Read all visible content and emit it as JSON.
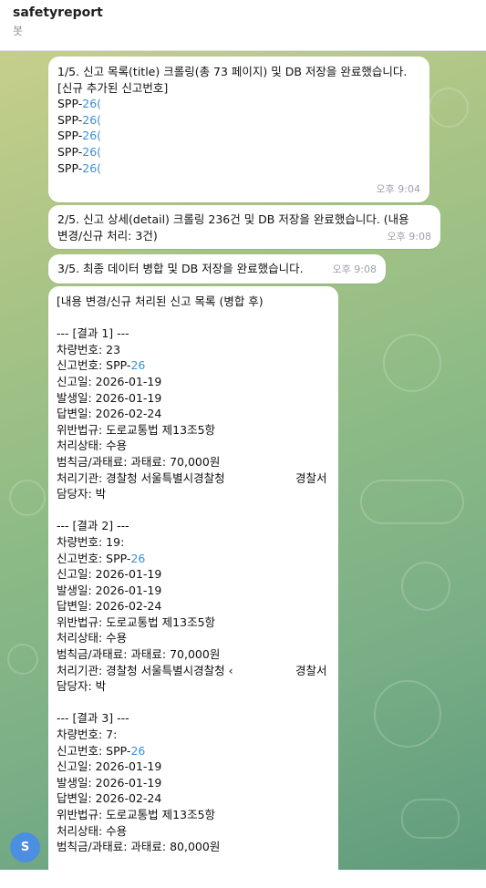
{
  "header": {
    "title": "safetyreport",
    "subtitle": "봇"
  },
  "messages": {
    "m1": {
      "lines": [
        "1/5. 신고 목록(title) 크롤링(총 73 페이지) 및 DB 저장을 완료했습니다.",
        "",
        "[신규 추가된 신고번호]"
      ],
      "spp_prefix": "SPP-",
      "spp_suffix": "26(",
      "time": "오후 9:04"
    },
    "m2": {
      "line1": "2/5. 신고 상세(detail) 크롤링 236건 및 DB 저장을 완료했습니다. (내용",
      "line2": "변경/신규 처리: 3건)",
      "time": "오후 9:08"
    },
    "m3": {
      "line1": "3/5. 최종 데이터 병합 및 DB 저장을 완료했습니다.",
      "time": "오후 9:08"
    },
    "m4": {
      "heading": "[내용 변경/신규 처리된 신고 목록 (병합 후)",
      "results": [
        {
          "header": "--- [결과 1] ---",
          "car": "차량번호: 23",
          "report_label": "신고번호: SPP-",
          "report_link": "26",
          "report_date": "신고일: 2026-01-19",
          "occur_date": "발생일: 2026-01-19",
          "answer_date": "답변일: 2026-02-24",
          "law": "위반법규: 도로교통법 제13조5항",
          "status": "처리상태: 수용",
          "fine": "범칙금/과태료: 과태료: 70,000원",
          "agency": "처리기관: 경찰청 서울특별시경찰청",
          "agency_tail": "경찰서",
          "manager": "담당자: 박"
        },
        {
          "header": "--- [결과 2] ---",
          "car": "차량번호: 19:",
          "report_label": "신고번호: SPP-",
          "report_link": "26",
          "report_date": "신고일: 2026-01-19",
          "occur_date": "발생일: 2026-01-19",
          "answer_date": "답변일: 2026-02-24",
          "law": "위반법규: 도로교통법 제13조5항",
          "status": "처리상태: 수용",
          "fine": "범칙금/과태료: 과태료: 70,000원",
          "agency": "처리기관: 경찰청 서울특별시경찰청 ‹",
          "agency_tail": "경찰서",
          "manager": "담당자: 박"
        },
        {
          "header": "--- [결과 3] ---",
          "car": "차량번호: 7:",
          "report_label": "신고번호: SPP-",
          "report_link": "26",
          "report_date": "신고일: 2026-01-19",
          "occur_date": "발생일: 2026-01-19",
          "answer_date": "답변일: 2026-02-24",
          "law": "위반법규: 도로교통법 제13조5항",
          "status": "처리상태: 수용",
          "fine": "범칙금/과태료: 과태료: 80,000원"
        }
      ]
    }
  },
  "avatar": {
    "letter": "S"
  }
}
